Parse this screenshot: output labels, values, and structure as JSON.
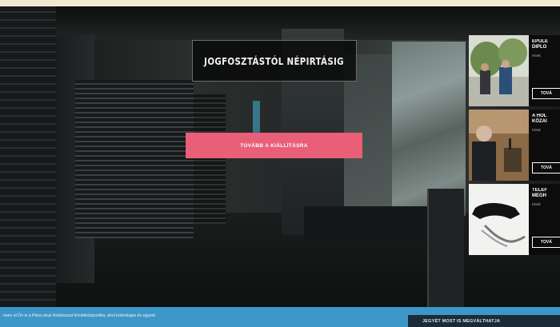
{
  "hero": {
    "title": "JOGFOSZTÁSTÓL NÉPIRTÁSIG",
    "cta_label": "TOVÁBB A KIÁLLÍTÁSRA"
  },
  "cards": [
    {
      "title": "ÉPÜLE\nDIPLO",
      "tag": "Hírek",
      "button": "TOVÁ"
    },
    {
      "title": "A HOL\nKÖZAI",
      "tag": "Hírek",
      "button": "TOVÁ"
    },
    {
      "title": "TELEF\nMEGH",
      "tag": "Hírek",
      "button": "TOVÁ"
    }
  ],
  "bottom_bar": {
    "text": "esen el Ön is a Páva utcai Holokauszt Emlékközpontba, ahol különleges és egyedi",
    "button_label": "JEGYÉT MOST IS MEGVÁLTHATJA"
  },
  "colors": {
    "cta": "#e85f77",
    "bottom_bar": "#3d96c8",
    "bottom_button": "#1b2b38"
  }
}
